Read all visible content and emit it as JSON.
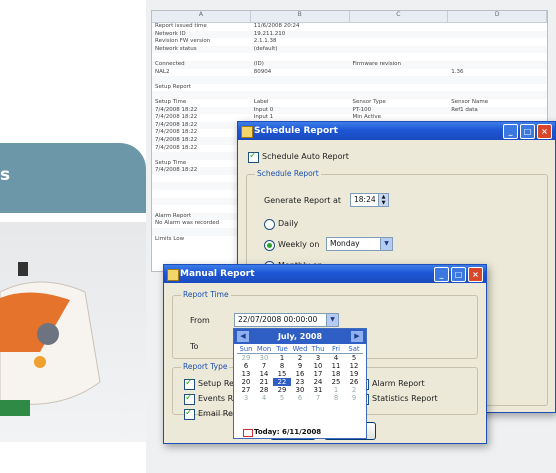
{
  "promo": {
    "band_text": "s"
  },
  "sheet": {
    "columns": [
      "A",
      "B",
      "C",
      "D"
    ],
    "rows": [
      [
        "Report issued time",
        "11/6/2008 20:24",
        "",
        ""
      ],
      [
        "Network ID",
        "19.211.210",
        "",
        ""
      ],
      [
        "Revision FW version",
        "2.1.1.38",
        "",
        ""
      ],
      [
        "Network status",
        "(default)",
        "",
        ""
      ],
      [
        "",
        "",
        "",
        ""
      ],
      [
        "Connected",
        "(ID)",
        "Firmware revision",
        ""
      ],
      [
        "NAL2",
        "80904",
        "",
        "1.36"
      ],
      [
        "",
        "",
        "",
        ""
      ],
      [
        "Setup Report",
        "",
        "",
        ""
      ],
      [
        "",
        "",
        "",
        ""
      ],
      [
        "Setup Time",
        "Label",
        "Sensor Type",
        "Sensor Name"
      ],
      [
        "7/4/2008 18:22",
        "Input 0",
        "PT-100",
        "Ref1 data"
      ],
      [
        "7/4/2008 18:22",
        "Input 1",
        "Min Active",
        ""
      ],
      [
        "7/4/2008 18:22",
        "Input 2",
        "",
        ""
      ],
      [
        "7/4/2008 18:22",
        "Input 3",
        "",
        ""
      ],
      [
        "7/4/2008 18:22",
        "",
        "",
        ""
      ],
      [
        "7/4/2008 18:22",
        "",
        "",
        ""
      ],
      [
        "",
        "",
        "",
        ""
      ],
      [
        "Setup Time",
        "",
        "",
        ""
      ],
      [
        "7/4/2008 18:22",
        "",
        "",
        ""
      ],
      [
        "",
        "",
        "",
        ""
      ],
      [
        "",
        "",
        "",
        ""
      ],
      [
        "",
        "",
        "",
        ""
      ],
      [
        "",
        "",
        "",
        ""
      ],
      [
        "",
        "",
        "",
        ""
      ],
      [
        "Alarm Report",
        "",
        "",
        ""
      ],
      [
        "No Alarm was recorded",
        "",
        "",
        ""
      ],
      [
        "",
        "",
        "",
        ""
      ],
      [
        "Limits Low",
        "",
        "",
        ""
      ]
    ]
  },
  "schedule": {
    "title": "Schedule Report",
    "auto_label": "Schedule Auto Report",
    "group_label": "Schedule Report",
    "generate_label": "Generate Report at",
    "time_value": "18:24",
    "daily_label": "Daily",
    "weekly_label": "Weekly on",
    "weekly_value": "Monday",
    "monthly_label": "Monthly on"
  },
  "manual": {
    "title": "Manual Report",
    "time_group": "Report Time",
    "from_label": "From",
    "from_value": "22/07/2008 00:00:00",
    "to_label": "To",
    "type_group": "Report Type",
    "setup_label": "Setup Report",
    "events_label": "Events Report",
    "email_label": "Email Report",
    "alarm_label": "Alarm Report",
    "statistics_label": "Statistics Report",
    "ok_label": "OK",
    "cancel_label": "Cancel"
  },
  "calendar": {
    "month": "July, 2008",
    "days": [
      "Sun",
      "Mon",
      "Tue",
      "Wed",
      "Thu",
      "Fri",
      "Sat"
    ],
    "weeks": [
      [
        "29",
        "30",
        "1",
        "2",
        "3",
        "4",
        "5"
      ],
      [
        "6",
        "7",
        "8",
        "9",
        "10",
        "11",
        "12"
      ],
      [
        "13",
        "14",
        "15",
        "16",
        "17",
        "18",
        "19"
      ],
      [
        "20",
        "21",
        "22",
        "23",
        "24",
        "25",
        "26"
      ],
      [
        "27",
        "28",
        "29",
        "30",
        "31",
        "1",
        "2"
      ],
      [
        "3",
        "4",
        "5",
        "6",
        "7",
        "8",
        "9"
      ]
    ],
    "selected": "22",
    "today": "Today: 6/11/2008"
  },
  "colors": {
    "titlebar": "#1d56d4",
    "teal": "#6b97a8",
    "window": "#ece9d8"
  }
}
